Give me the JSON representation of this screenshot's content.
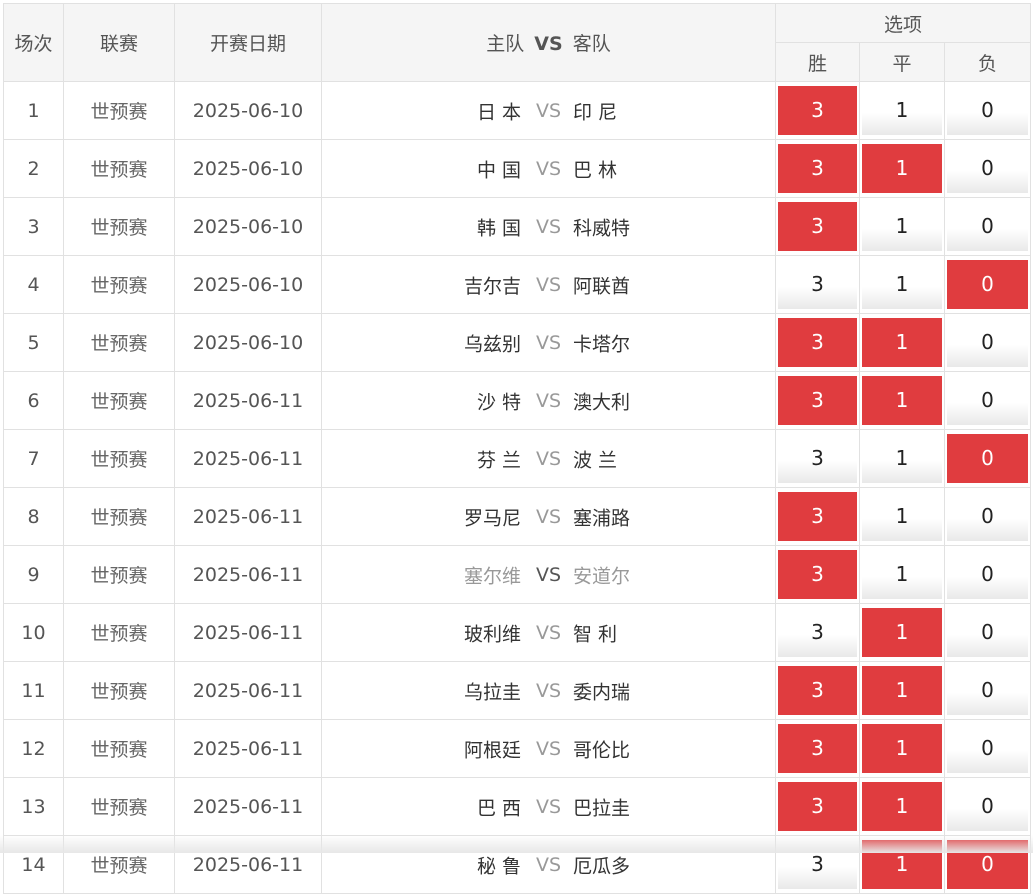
{
  "header": {
    "col_index": "场次",
    "col_league": "联赛",
    "col_date": "开赛日期",
    "col_home": "主队",
    "col_vs": "VS",
    "col_away": "客队",
    "col_options": "选项",
    "opt_win": "胜",
    "opt_draw": "平",
    "opt_lose": "负"
  },
  "matches": [
    {
      "index": "1",
      "league": "世预赛",
      "date": "2025-06-10",
      "home": "日 本",
      "vs": "VS",
      "away": "印 尼",
      "win": "3",
      "draw": "1",
      "lose": "0",
      "sel": [
        true,
        false,
        false
      ]
    },
    {
      "index": "2",
      "league": "世预赛",
      "date": "2025-06-10",
      "home": "中 国",
      "vs": "VS",
      "away": "巴 林",
      "win": "3",
      "draw": "1",
      "lose": "0",
      "sel": [
        true,
        true,
        false
      ]
    },
    {
      "index": "3",
      "league": "世预赛",
      "date": "2025-06-10",
      "home": "韩 国",
      "vs": "VS",
      "away": "科威特",
      "win": "3",
      "draw": "1",
      "lose": "0",
      "sel": [
        true,
        false,
        false
      ]
    },
    {
      "index": "4",
      "league": "世预赛",
      "date": "2025-06-10",
      "home": "吉尔吉",
      "vs": "VS",
      "away": "阿联酋",
      "win": "3",
      "draw": "1",
      "lose": "0",
      "sel": [
        false,
        false,
        true
      ]
    },
    {
      "index": "5",
      "league": "世预赛",
      "date": "2025-06-10",
      "home": "乌兹别",
      "vs": "VS",
      "away": "卡塔尔",
      "win": "3",
      "draw": "1",
      "lose": "0",
      "sel": [
        true,
        true,
        false
      ]
    },
    {
      "index": "6",
      "league": "世预赛",
      "date": "2025-06-11",
      "home": "沙 特",
      "vs": "VS",
      "away": "澳大利",
      "win": "3",
      "draw": "1",
      "lose": "0",
      "sel": [
        true,
        true,
        false
      ]
    },
    {
      "index": "7",
      "league": "世预赛",
      "date": "2025-06-11",
      "home": "芬 兰",
      "vs": "VS",
      "away": "波 兰",
      "win": "3",
      "draw": "1",
      "lose": "0",
      "sel": [
        false,
        false,
        true
      ]
    },
    {
      "index": "8",
      "league": "世预赛",
      "date": "2025-06-11",
      "home": "罗马尼",
      "vs": "VS",
      "away": "塞浦路",
      "win": "3",
      "draw": "1",
      "lose": "0",
      "sel": [
        true,
        false,
        false
      ]
    },
    {
      "index": "9",
      "league": "世预赛",
      "date": "2025-06-11",
      "home": "塞尔维",
      "vs": "VS",
      "away": "安道尔",
      "win": "3",
      "draw": "1",
      "lose": "0",
      "sel": [
        true,
        false,
        false
      ],
      "dim": true
    },
    {
      "index": "10",
      "league": "世预赛",
      "date": "2025-06-11",
      "home": "玻利维",
      "vs": "VS",
      "away": "智 利",
      "win": "3",
      "draw": "1",
      "lose": "0",
      "sel": [
        false,
        true,
        false
      ]
    },
    {
      "index": "11",
      "league": "世预赛",
      "date": "2025-06-11",
      "home": "乌拉圭",
      "vs": "VS",
      "away": "委内瑞",
      "win": "3",
      "draw": "1",
      "lose": "0",
      "sel": [
        true,
        true,
        false
      ]
    },
    {
      "index": "12",
      "league": "世预赛",
      "date": "2025-06-11",
      "home": "阿根廷",
      "vs": "VS",
      "away": "哥伦比",
      "win": "3",
      "draw": "1",
      "lose": "0",
      "sel": [
        true,
        true,
        false
      ]
    },
    {
      "index": "13",
      "league": "世预赛",
      "date": "2025-06-11",
      "home": "巴 西",
      "vs": "VS",
      "away": "巴拉圭",
      "win": "3",
      "draw": "1",
      "lose": "0",
      "sel": [
        true,
        true,
        false
      ]
    },
    {
      "index": "14",
      "league": "世预赛",
      "date": "2025-06-11",
      "home": "秘 鲁",
      "vs": "VS",
      "away": "厄瓜多",
      "win": "3",
      "draw": "1",
      "lose": "0",
      "sel": [
        false,
        true,
        true
      ]
    }
  ],
  "colors": {
    "selected_bg": "#e03c3f",
    "selected_text": "#ffffff",
    "header_bg": "#f5f5f5"
  }
}
